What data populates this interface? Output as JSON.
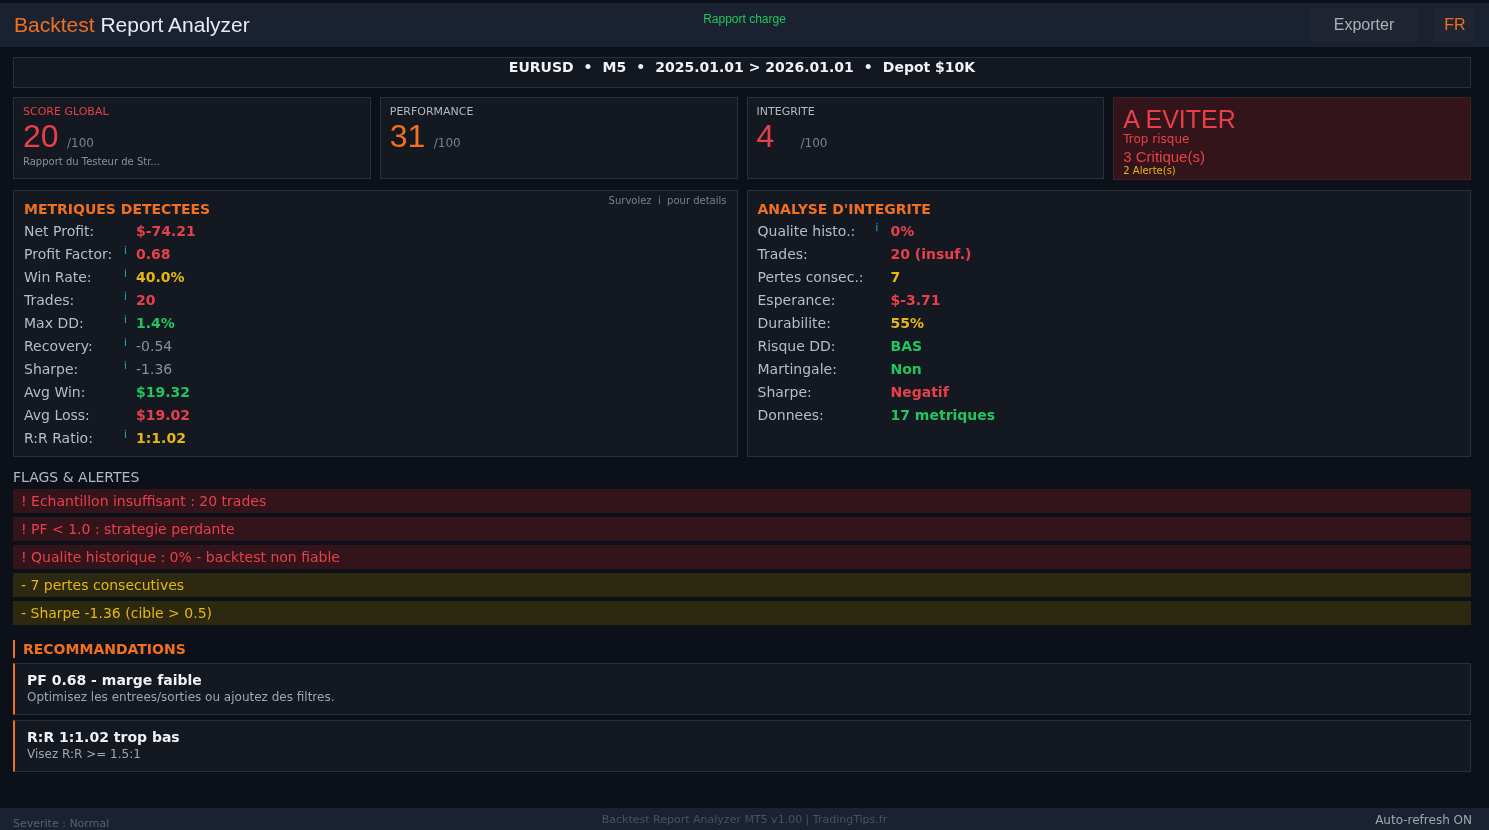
{
  "header": {
    "title_accent": "Backtest",
    "title_rest": "Report Analyzer",
    "status": "Rapport charge",
    "export_button": "Exporter",
    "language_button": "FR"
  },
  "info_bar": {
    "items": [
      "EURUSD",
      "M5",
      "2025.01.01 > 2026.01.01",
      "Depot $10K"
    ],
    "separator": "•"
  },
  "scores": [
    {
      "label": "SCORE GLOBAL",
      "value": "20",
      "suffix": "/100",
      "note": "Rapport du Testeur de Str...",
      "color": "#e8404a",
      "emphasized": true
    },
    {
      "label": "PERFORMANCE",
      "value": "31",
      "suffix": "/100",
      "color": "#f07020",
      "emphasized": false
    },
    {
      "label": "INTEGRITE",
      "value": "4",
      "suffix": "/100",
      "color": "#e8404a",
      "emphasized": false
    }
  ],
  "verdict": {
    "title": "A EVITER",
    "subtitle": "Trop risque",
    "critical": "3 Critique(s)",
    "alerts": "2 Alerte(s)"
  },
  "metrics": {
    "title": "METRIQUES DETECTEES",
    "hint": "Survolez  i  pour details",
    "rows": [
      {
        "label": "Net Profit:",
        "value": "$-74.21",
        "color": "#e8404a"
      },
      {
        "label": "Profit Factor:",
        "info": "i",
        "value": "0.68",
        "color": "#e8404a"
      },
      {
        "label": "Win Rate:",
        "info": "i",
        "value": "40.0%",
        "color": "#e8b810"
      },
      {
        "label": "Trades:",
        "info": "i",
        "value": "20",
        "color": "#e8404a"
      },
      {
        "label": "Max DD:",
        "info": "i",
        "value": "1.4%",
        "color": "#22c55e"
      },
      {
        "label": "Recovery:",
        "info": "i",
        "value": "-0.54",
        "color": "#8a8f98"
      },
      {
        "label": "Sharpe:",
        "info": "i",
        "value": "-1.36",
        "color": "#8a8f98"
      },
      {
        "label": "Avg Win:",
        "value": "$19.32",
        "color": "#22c55e"
      },
      {
        "label": "Avg Loss:",
        "value": "$19.02",
        "color": "#e8404a"
      },
      {
        "label": "R:R Ratio:",
        "info": "i",
        "value": "1:1.02",
        "color": "#e8b810"
      }
    ]
  },
  "integrity": {
    "title": "ANALYSE D'INTEGRITE",
    "rows": [
      {
        "label": "Qualite histo.:",
        "info": "i",
        "value": "0%",
        "color": "#e8404a"
      },
      {
        "label": "Trades:",
        "value": "20 (insuf.)",
        "color": "#e8404a"
      },
      {
        "label": "Pertes consec.:",
        "value": "7",
        "color": "#e8b810"
      },
      {
        "label": "Esperance:",
        "value": "$-3.71",
        "color": "#e8404a"
      },
      {
        "label": "Durabilite:",
        "value": "55%",
        "color": "#e8b810"
      },
      {
        "label": "Risque DD:",
        "value": "BAS",
        "color": "#22c55e"
      },
      {
        "label": "Martingale:",
        "value": "Non",
        "color": "#22c55e"
      },
      {
        "label": "Sharpe:",
        "value": "Negatif",
        "color": "#e8404a"
      },
      {
        "label": "Donnees:",
        "value": "17 metriques",
        "color": "#22c55e"
      }
    ]
  },
  "flags": {
    "title": "FLAGS & ALERTES",
    "items": [
      {
        "text": "! Echantillon insuffisant : 20 trades",
        "kind": "critical"
      },
      {
        "text": "! PF < 1.0 : strategie perdante",
        "kind": "critical"
      },
      {
        "text": "! Qualite historique : 0% - backtest non fiable",
        "kind": "critical"
      },
      {
        "text": "- 7 pertes consecutives",
        "kind": "warning"
      },
      {
        "text": "- Sharpe -1.36 (cible > 0.5)",
        "kind": "warning"
      }
    ]
  },
  "recommendations": {
    "title": "RECOMMANDATIONS",
    "items": [
      {
        "title": "PF 0.68 - marge faible",
        "detail": "Optimisez les entrees/sorties ou ajoutez des filtres."
      },
      {
        "title": "R:R 1:1.02 trop bas",
        "detail": "Visez R:R >= 1.5:1"
      }
    ]
  },
  "footer": {
    "severity": "Severite : Normal",
    "credits": "Backtest Report Analyzer MT5 v1.00 | TradingTips.fr",
    "auto_refresh": "Auto-refresh ON"
  }
}
